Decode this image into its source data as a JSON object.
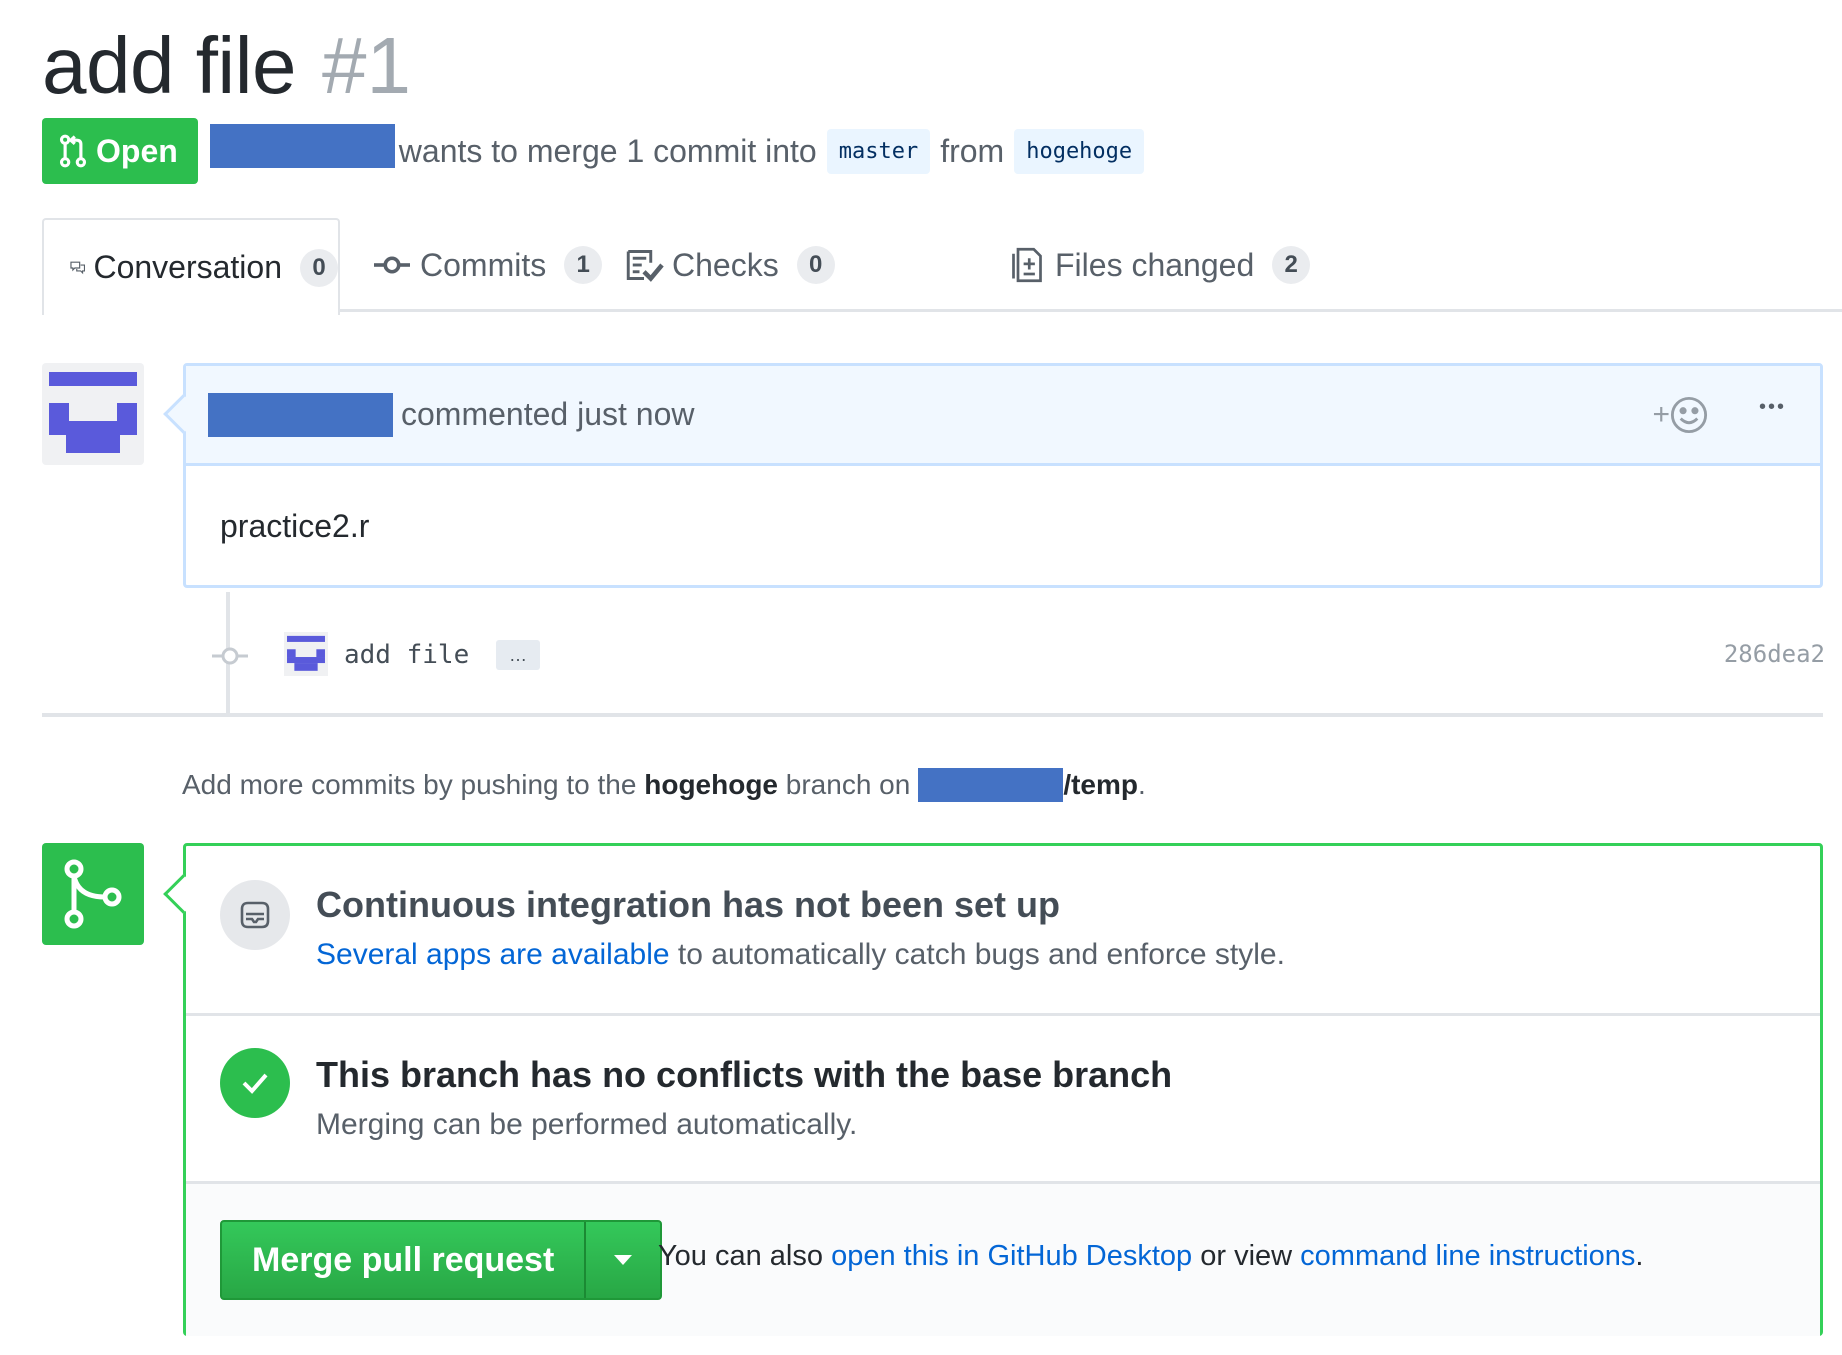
{
  "pr": {
    "title": "add file",
    "number": "#1",
    "state": "Open",
    "merge_text_1": "wants to merge 1 commit into",
    "base_branch": "master",
    "merge_text_2": "from",
    "head_branch": "hogehoge"
  },
  "tabs": [
    {
      "label": "Conversation",
      "count": "0",
      "icon": "comment-discussion-icon"
    },
    {
      "label": "Commits",
      "count": "1",
      "icon": "git-commit-icon"
    },
    {
      "label": "Checks",
      "count": "0",
      "icon": "checklist-icon"
    },
    {
      "label": "Files changed",
      "count": "2",
      "icon": "file-diff-icon"
    }
  ],
  "comment": {
    "action": "commented just now",
    "body": "practice2.r",
    "reaction_plus": "+",
    "more": "•••"
  },
  "commit": {
    "message": "add file",
    "ellipsis": "…",
    "sha": "286dea2"
  },
  "push_hint": {
    "prefix": "Add more commits by pushing to the",
    "branch": "hogehoge",
    "middle": "branch on",
    "repo": "/temp",
    "suffix": "."
  },
  "merge_box": {
    "ci_title": "Continuous integration has not been set up",
    "ci_link": "Several apps are available",
    "ci_text": "to automatically catch bugs and enforce style.",
    "conflict_title": "This branch has no conflicts with the base branch",
    "conflict_sub": "Merging can be performed automatically.",
    "merge_button": "Merge pull request",
    "alt_prefix": "You can also",
    "alt_link_1": "open this in GitHub Desktop",
    "alt_middle": "or view",
    "alt_link_2": "command line instructions",
    "alt_suffix": "."
  },
  "colors": {
    "open_green": "#2cbe4e",
    "link_blue": "#0366d6",
    "redaction_blue": "#4472c4",
    "avatar_purple": "#5a5adb"
  }
}
